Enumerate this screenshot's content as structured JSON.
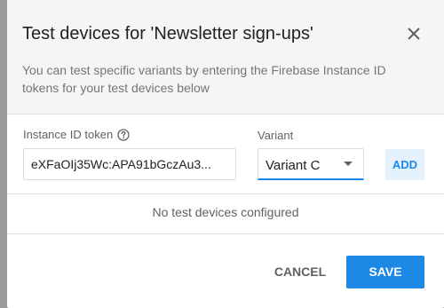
{
  "dialog": {
    "title": "Test devices for 'Newsletter sign-ups'",
    "description": "You can test specific variants by entering the Firebase Instance ID tokens for your test devices below",
    "close_icon": "close-icon"
  },
  "form": {
    "token_label": "Instance ID token",
    "token_help_icon": "help-circle-icon",
    "token_value": "eXFaOIj35Wc:APA91bGczAu3...",
    "variant_label": "Variant",
    "variant_selected": "Variant C",
    "variant_caret_icon": "chevron-down-icon",
    "add_label": "ADD"
  },
  "devices": {
    "empty_message": "No test devices configured"
  },
  "actions": {
    "cancel_label": "CANCEL",
    "save_label": "SAVE"
  },
  "colors": {
    "accent": "#1e88e5",
    "add_button_bg": "#e3f2fd",
    "header_bg": "#f5f5f5"
  }
}
